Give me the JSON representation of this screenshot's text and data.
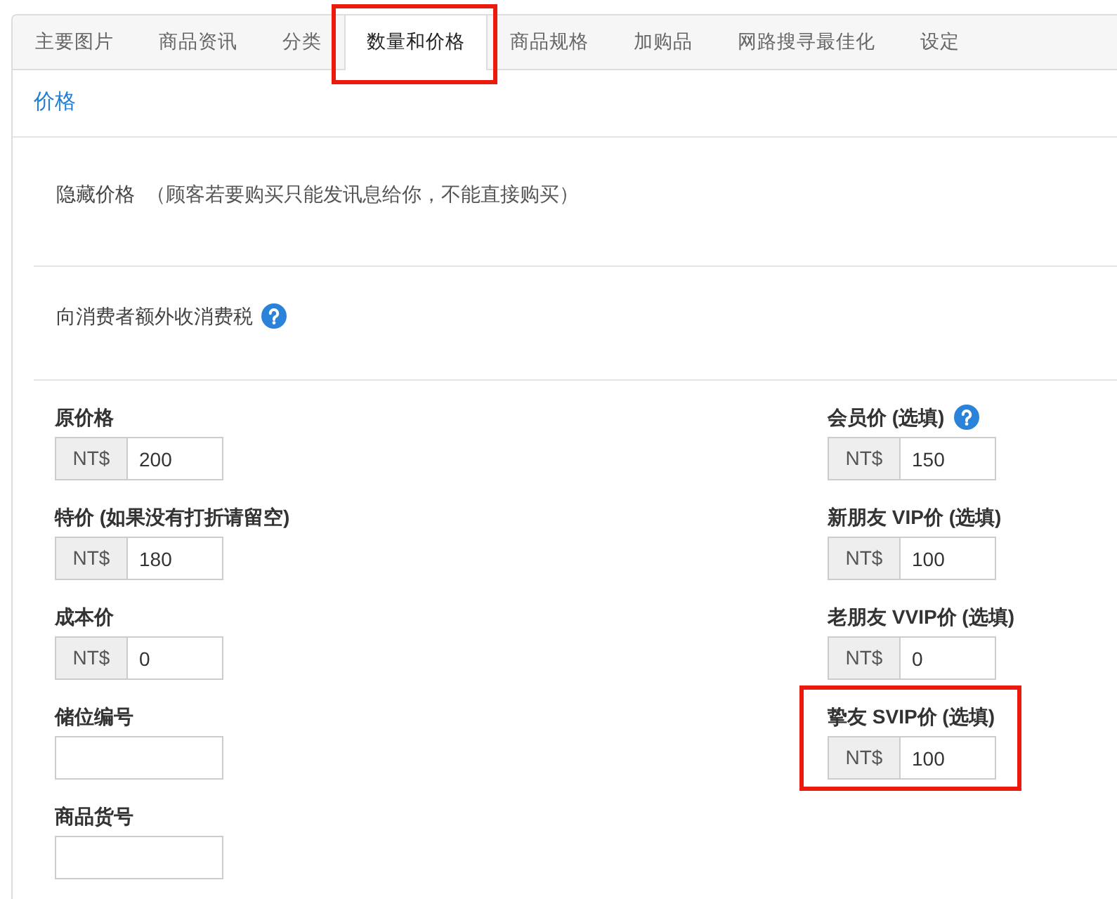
{
  "tabs": [
    {
      "label": "主要图片",
      "selected": false
    },
    {
      "label": "商品资讯",
      "selected": false
    },
    {
      "label": "分类",
      "selected": false
    },
    {
      "label": "数量和价格",
      "selected": true,
      "highlighted": true
    },
    {
      "label": "商品规格",
      "selected": false
    },
    {
      "label": "加购品",
      "selected": false
    },
    {
      "label": "网路搜寻最佳化",
      "selected": false
    },
    {
      "label": "设定",
      "selected": false
    }
  ],
  "section": {
    "title": "价格"
  },
  "options": [
    {
      "label": "隐藏价格",
      "note": "（顾客若要购买只能发讯息给你，不能直接购买）"
    },
    {
      "label": "向消费者额外收消费税",
      "help": true
    }
  ],
  "fields_left": [
    {
      "label": "原价格",
      "prefix": "NT$",
      "value": "200"
    },
    {
      "label": "特价 (如果没有打折请留空)",
      "prefix": "NT$",
      "value": "180"
    },
    {
      "label": "成本价",
      "prefix": "NT$",
      "value": "0"
    },
    {
      "label": "储位编号"
    },
    {
      "label": "商品货号"
    }
  ],
  "fields_right": [
    {
      "label": "会员价 (选填)",
      "prefix": "NT$",
      "value": "150",
      "help": true
    },
    {
      "label": "新朋友 VIP价 (选填)",
      "prefix": "NT$",
      "value": "100"
    },
    {
      "label": "老朋友 VVIP价 (选填)",
      "prefix": "NT$",
      "value": "0"
    },
    {
      "label": "挚友 SVIP价 (选填)",
      "prefix": "NT$",
      "value": "100",
      "highlighted": true
    }
  ]
}
